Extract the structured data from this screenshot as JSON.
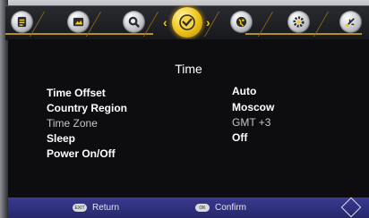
{
  "header": {
    "tabs": [
      {
        "name": "info-tab",
        "icon": "info-icon"
      },
      {
        "name": "picture-tab",
        "icon": "picture-icon"
      },
      {
        "name": "search-tab",
        "icon": "search-icon"
      },
      {
        "name": "time-tab",
        "icon": "clock-icon",
        "active": true
      },
      {
        "name": "network-tab",
        "icon": "globe-icon"
      },
      {
        "name": "settings-tab",
        "icon": "gear-icon"
      },
      {
        "name": "usb-tab",
        "icon": "usb-icon"
      }
    ],
    "arrows": {
      "left": "‹",
      "right": "›"
    },
    "active_color": "#f2c61b"
  },
  "menu": {
    "title": "Time",
    "rows": [
      {
        "label": "Time Offset",
        "value": "Auto"
      },
      {
        "label": "Country Region",
        "value": "Moscow"
      },
      {
        "label": "Time Zone",
        "value": "GMT +3",
        "disabled": true
      },
      {
        "label": "Sleep",
        "value": "Off"
      },
      {
        "label": "Power On/Off",
        "value": ""
      }
    ]
  },
  "footer": {
    "return_key": "EXIT",
    "return_label": "Return",
    "confirm_key": "OK",
    "confirm_label": "Confirm",
    "bar_color": "#2f2f7e"
  }
}
